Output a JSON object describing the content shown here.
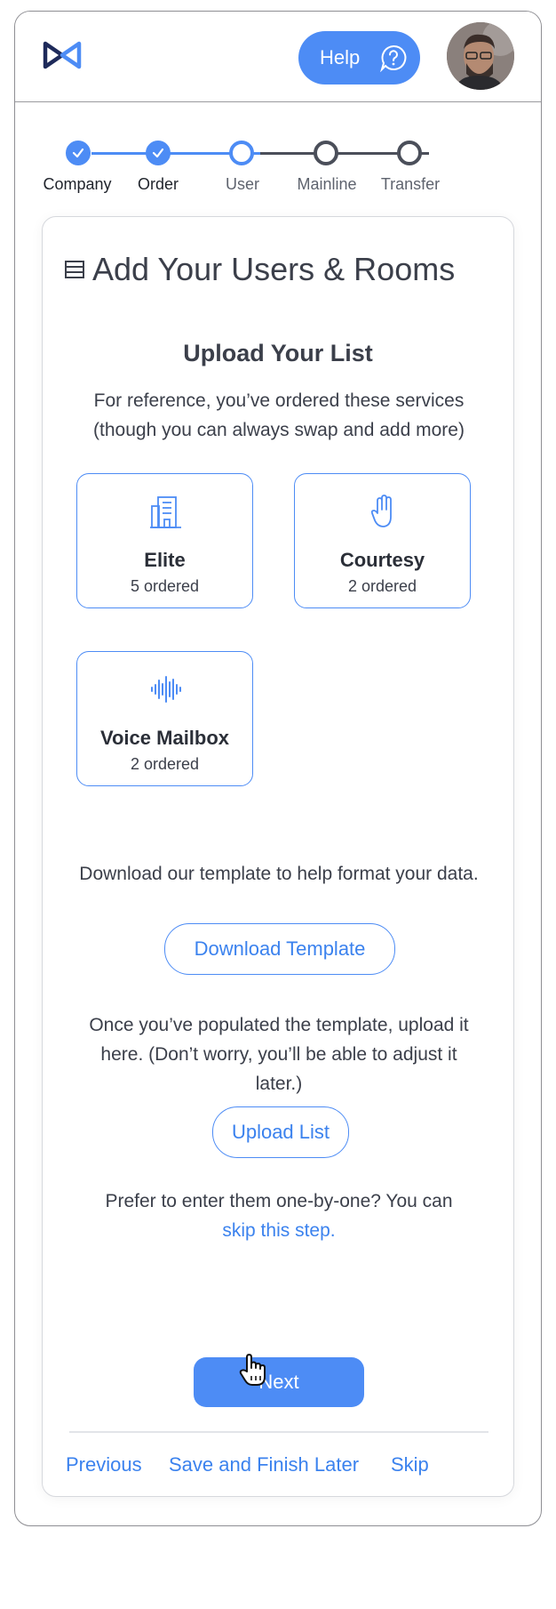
{
  "header": {
    "help_label": "Help",
    "brand_color": "#4d8cf5"
  },
  "stepper": {
    "steps": [
      {
        "label": "Company",
        "state": "done"
      },
      {
        "label": "Order",
        "state": "done"
      },
      {
        "label": "User",
        "state": "current"
      },
      {
        "label": "Mainline",
        "state": "todo"
      },
      {
        "label": "Transfer",
        "state": "todo"
      }
    ]
  },
  "card": {
    "title": "Add Your Users & Rooms",
    "upload_heading": "Upload Your List",
    "reference_text": "For reference, you’ve ordered these services (though you can always swap and add more)",
    "services": [
      {
        "name": "Elite",
        "count": "5 ordered",
        "icon": "building-icon"
      },
      {
        "name": "Courtesy",
        "count": "2 ordered",
        "icon": "hand-icon"
      },
      {
        "name": "Voice Mailbox",
        "count": "2 ordered",
        "icon": "soundwave-icon"
      }
    ],
    "download_text": "Download our template to help format your data.",
    "download_button": "Download Template",
    "upload_text": "Once you’ve populated the template, upload it here. (Don’t worry, you’ll be able to adjust it later.)",
    "upload_button": "Upload List",
    "prefer_text": "Prefer to enter them one-by-one? You can",
    "skip_step_link": "skip this step.",
    "next_button": "Next"
  },
  "footer": {
    "previous": "Previous",
    "save_later": "Save and Finish Later",
    "skip": "Skip"
  }
}
